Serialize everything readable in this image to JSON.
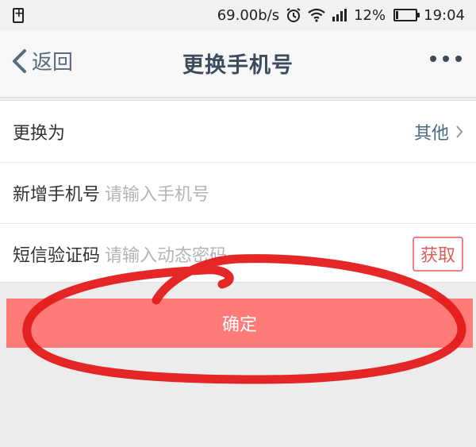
{
  "status_bar": {
    "speed": "69.00b/s",
    "battery_text": "12%",
    "battery_level": 0.12,
    "time": "19:04",
    "icons": [
      "sim-icon",
      "alarm-icon",
      "wifi-icon",
      "signal-icon",
      "battery-icon"
    ]
  },
  "nav": {
    "back_label": "返回",
    "title": "更换手机号"
  },
  "form": {
    "change_to_label": "更换为",
    "change_to_value": "其他",
    "new_phone_label": "新增手机号",
    "new_phone_placeholder": "请输入手机号",
    "sms_label": "短信验证码",
    "sms_placeholder": "请输入动态密码",
    "get_code_label": "获取"
  },
  "confirm_label": "确定",
  "colors": {
    "confirm_bg": "#ff7b78",
    "annotation": "#e41b1b",
    "title": "#3d4b5c"
  }
}
